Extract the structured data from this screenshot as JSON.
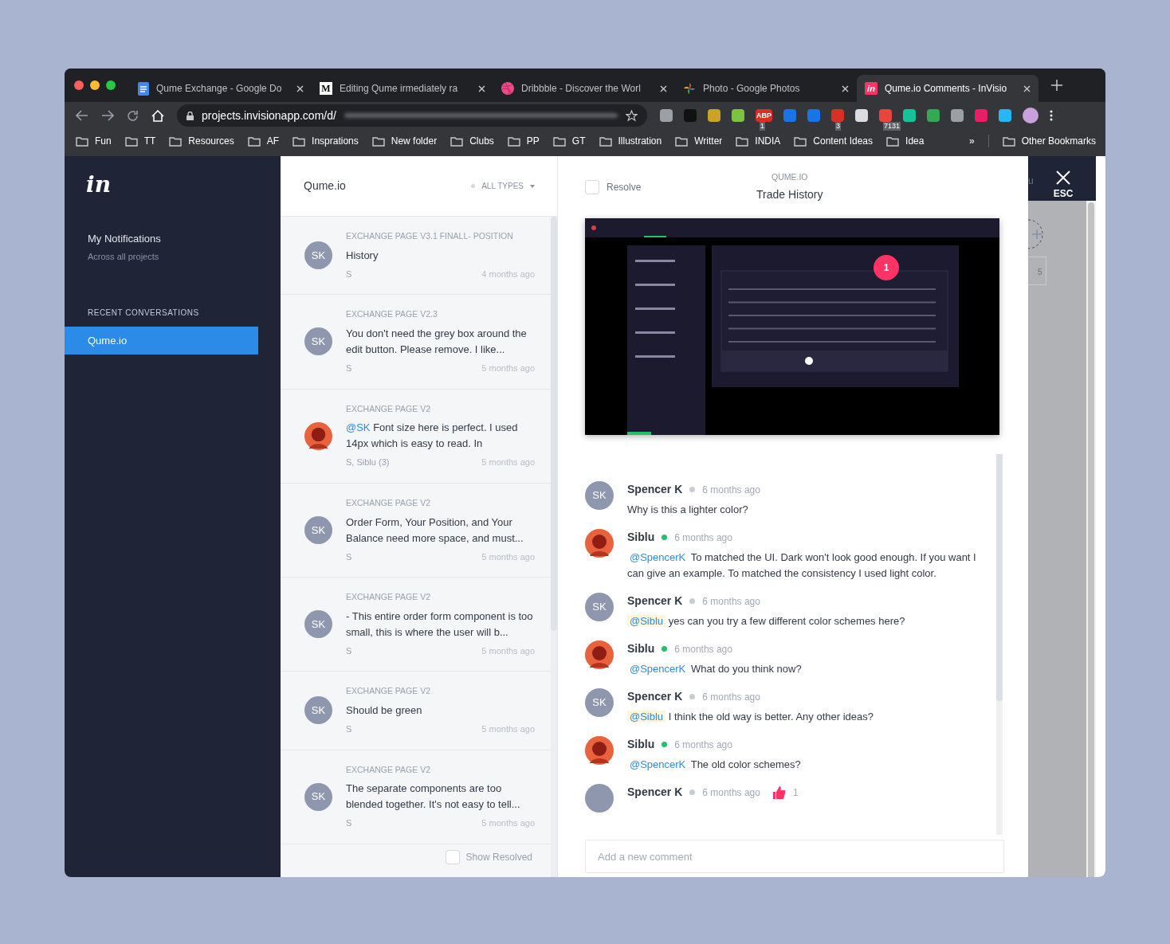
{
  "browser": {
    "tabs": [
      {
        "kind": "docs",
        "title": "Qume Exchange - Google Do",
        "selected": false
      },
      {
        "kind": "medium",
        "icon_text": "M",
        "title": "Editing Qume irmediately ra",
        "selected": false
      },
      {
        "kind": "dribbble",
        "title": "Dribbble - Discover the Worl",
        "selected": false
      },
      {
        "kind": "photos",
        "title": "Photo - Google Photos",
        "selected": false
      },
      {
        "kind": "invision",
        "icon_text": "in",
        "title": "Qume.io Comments - InVisio",
        "selected": true
      }
    ],
    "url": "projects.invisionapp.com/d/",
    "extensions": [
      {
        "color": "#9aa0a6"
      },
      {
        "color": "#111111"
      },
      {
        "color": "#c9a227"
      },
      {
        "color": "#7cc243"
      },
      {
        "color": "#d93025",
        "label": "ABP",
        "badge": "1"
      },
      {
        "color": "#1a73e8"
      },
      {
        "color": "#1a73e8"
      },
      {
        "color": "#d93025",
        "badge": "3"
      },
      {
        "color": "#dadce0"
      },
      {
        "color": "#e8453c",
        "badge": "7131"
      },
      {
        "color": "#15c39a"
      },
      {
        "color": "#34a853"
      },
      {
        "color": "#9aa0a6"
      },
      {
        "color": "#e91e63"
      },
      {
        "color": "#29b6f6"
      }
    ],
    "bookmarks": [
      "Fun",
      "TT",
      "Resources",
      "AF",
      "Insprations",
      "New folder",
      "Clubs",
      "PP",
      "GT",
      "Illustration",
      "Writter",
      "INDIA",
      "Content Ideas",
      "Idea"
    ],
    "more": "»",
    "other_bookmarks": "Other Bookmarks"
  },
  "sidebar": {
    "logo": "in",
    "title": "My Notifications",
    "subtitle": "Across all projects",
    "section": "RECENT CONVERSATIONS",
    "items": [
      {
        "label": "Qume.io",
        "selected": true
      }
    ]
  },
  "conversations": {
    "title": "Qume.io",
    "filter": "ALL TYPES",
    "items": [
      {
        "kind": "initials",
        "initials": "SK",
        "screen": "EXCHANGE PAGE V3.1 FINALL- POSITION",
        "text": "History",
        "authors": "S",
        "time": "4 months ago"
      },
      {
        "kind": "initials",
        "initials": "SK",
        "screen": "EXCHANGE PAGE V2.3",
        "text": "You don't need the grey box around the edit button. Please remove. I like...",
        "authors": "S",
        "time": "5 months ago"
      },
      {
        "screen": "EXCHANGE PAGE V2",
        "mention": "@SK",
        "text": "Font size here is perfect. I used 14px which is easy to read. In",
        "authors": "S, Siblu (3)",
        "time": "5 months ago"
      },
      {
        "kind": "initials",
        "initials": "SK",
        "screen": "EXCHANGE PAGE V2",
        "text": "Order Form, Your Position, and Your Balance need more space, and must...",
        "authors": "S",
        "time": "5 months ago"
      },
      {
        "kind": "initials",
        "initials": "SK",
        "screen": "EXCHANGE PAGE V2",
        "text": "- This entire order form component is too small, this is where the user will b...",
        "authors": "S",
        "time": "5 months ago"
      },
      {
        "kind": "initials",
        "initials": "SK",
        "screen": "EXCHANGE PAGE V2",
        "text": "Should be green",
        "authors": "S",
        "time": "5 months ago"
      },
      {
        "kind": "initials",
        "initials": "SK",
        "screen": "EXCHANGE PAGE V2",
        "text": "The separate components are too blended together. It's not easy to tell...",
        "authors": "S",
        "time": "5 months ago"
      }
    ],
    "show_resolved": {
      "label": "Show Resolved",
      "checked": false
    }
  },
  "detail": {
    "resolve": {
      "label": "Resolve",
      "checked": false
    },
    "project": "QUME.IO",
    "screen": "Trade History",
    "preview": {
      "kind": "picture",
      "pin": "1"
    },
    "comments": [
      {
        "kind": "initials",
        "initials": "SK",
        "name": "Spencer K",
        "color": "#c8ccd4",
        "time": "6 months ago",
        "text": "Why is this a lighter color?"
      },
      {
        "name": "Siblu",
        "color": "#21c06a",
        "time": "6 months ago",
        "mention": "@SpencerK",
        "mention_highlighted": false,
        "text": "To matched the UI. Dark won't look good enough. If you want I can give an example. To matched the consistency I used light color."
      },
      {
        "kind": "initials",
        "initials": "SK",
        "name": "Spencer K",
        "color": "#c8ccd4",
        "time": "6 months ago",
        "mention": "@Siblu",
        "mention_highlighted": true,
        "text": "yes can you try a few different color schemes here?"
      },
      {
        "name": "Siblu",
        "color": "#21c06a",
        "time": "6 months ago",
        "mention": "@SpencerK",
        "mention_highlighted": false,
        "text": "What do you think now?"
      },
      {
        "kind": "initials",
        "initials": "SK",
        "name": "Spencer K",
        "color": "#c8ccd4",
        "time": "6 months ago",
        "mention": "@Siblu",
        "mention_highlighted": true,
        "text": "I think the old way is better. Any other ideas?"
      },
      {
        "name": "Siblu",
        "color": "#21c06a",
        "time": "6 months ago",
        "mention": "@SpencerK",
        "mention_highlighted": false,
        "text": "The old color schemes?"
      },
      {
        "kind": "blank",
        "name": "Spencer K",
        "color": "#c8ccd4",
        "time": "6 months ago",
        "likes": "1"
      }
    ],
    "comment_field": {
      "placeholder": "Add a new comment"
    }
  },
  "background_page": {
    "menu_fragment": "u",
    "close_label": "ESC",
    "field_fragment": "5"
  }
}
